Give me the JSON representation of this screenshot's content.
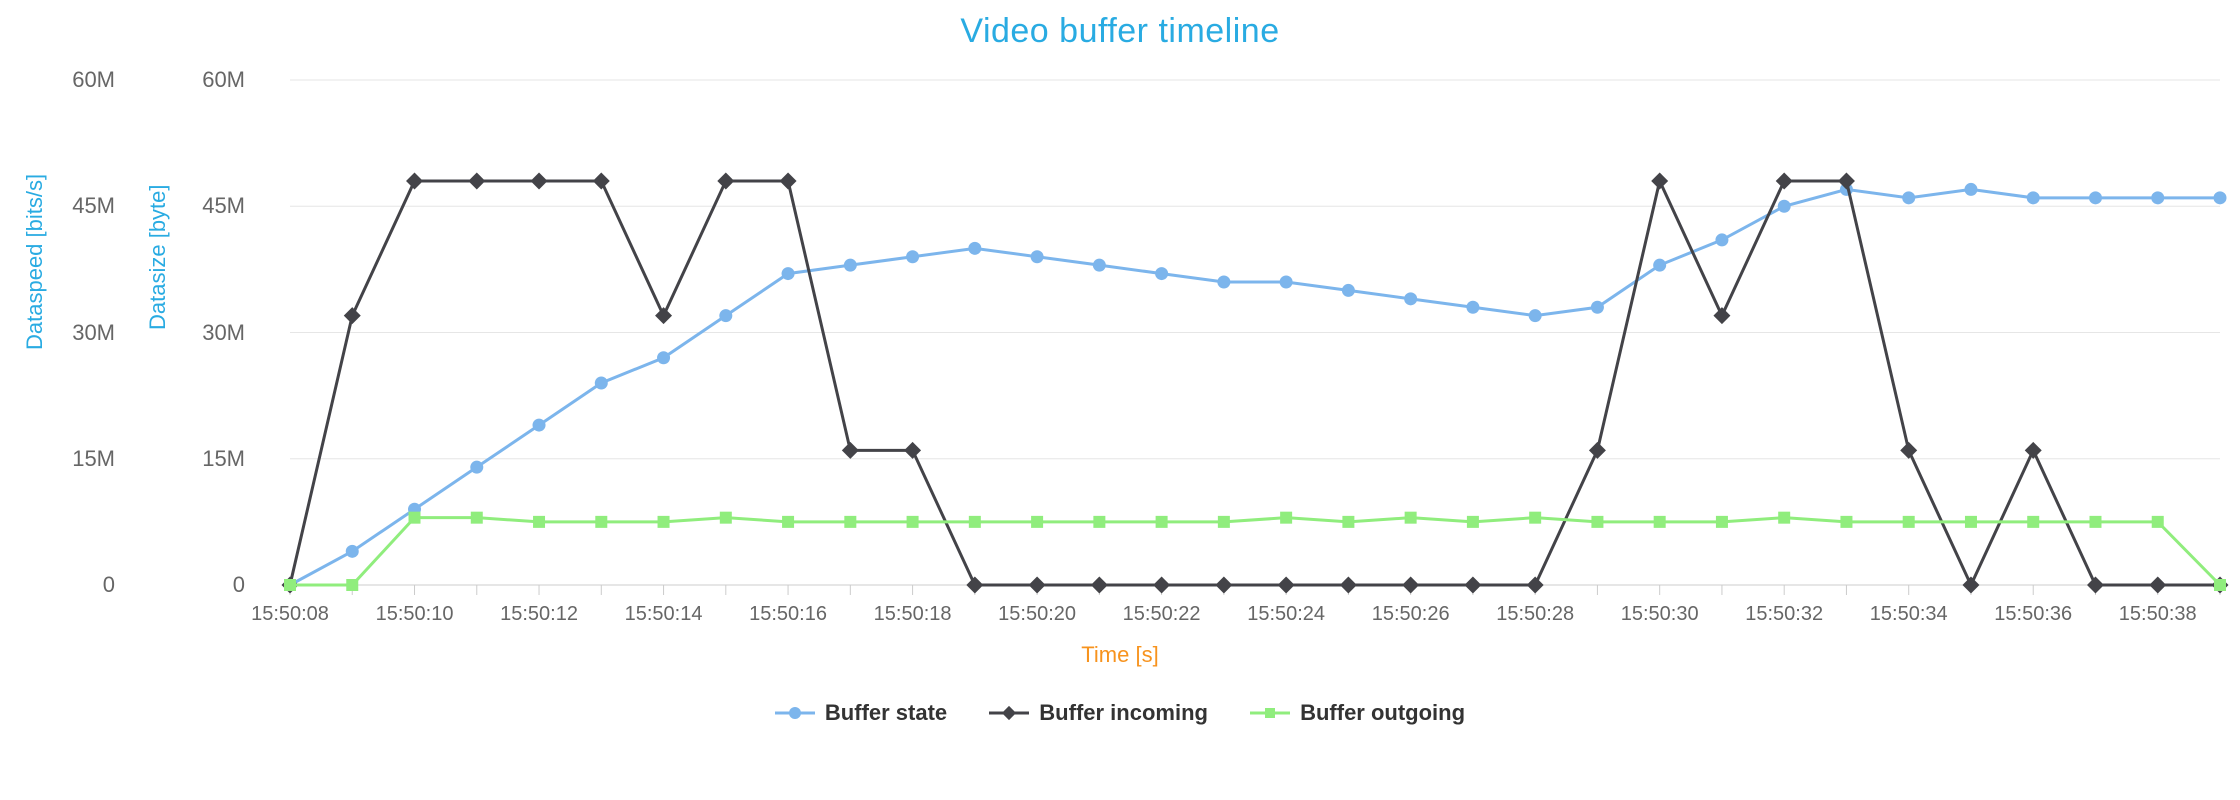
{
  "title": "Video buffer timeline",
  "axes": {
    "y1_label": "Dataspeed [bits/s]",
    "y2_label": "Datasize [byte]",
    "x_label": "Time [s]",
    "y_ticks": [
      "0",
      "15M",
      "30M",
      "45M",
      "60M"
    ],
    "x_ticks": [
      "15:50:08",
      "15:50:10",
      "15:50:12",
      "15:50:14",
      "15:50:16",
      "15:50:18",
      "15:50:20",
      "15:50:22",
      "15:50:24",
      "15:50:26",
      "15:50:28",
      "15:50:30",
      "15:50:32",
      "15:50:34",
      "15:50:36",
      "15:50:38"
    ]
  },
  "legend": {
    "s1": "Buffer state",
    "s2": "Buffer incoming",
    "s3": "Buffer outgoing"
  },
  "colors": {
    "title": "#29abe2",
    "xlabel": "#f7931e",
    "series_state": "#7cb5ec",
    "series_incoming": "#434348",
    "series_outgoing": "#90ed7d",
    "grid": "#e6e6e6",
    "tick": "#666666"
  },
  "chart_data": {
    "type": "line",
    "title": "Video buffer timeline",
    "xlabel": "Time [s]",
    "ylabel_left": "Dataspeed [bits/s]",
    "ylabel_right": "Datasize [byte]",
    "ylim": [
      0,
      60
    ],
    "y_unit": "M",
    "x": [
      "15:50:08",
      "15:50:09",
      "15:50:10",
      "15:50:11",
      "15:50:12",
      "15:50:13",
      "15:50:14",
      "15:50:15",
      "15:50:16",
      "15:50:17",
      "15:50:18",
      "15:50:19",
      "15:50:20",
      "15:50:21",
      "15:50:22",
      "15:50:23",
      "15:50:24",
      "15:50:25",
      "15:50:26",
      "15:50:27",
      "15:50:28",
      "15:50:29",
      "15:50:30",
      "15:50:31",
      "15:50:32",
      "15:50:33",
      "15:50:34",
      "15:50:35",
      "15:50:36",
      "15:50:37",
      "15:50:38",
      "15:50:39"
    ],
    "series": [
      {
        "name": "Buffer state",
        "color": "#7cb5ec",
        "marker": "circle",
        "values": [
          0,
          4,
          9,
          14,
          19,
          24,
          27,
          32,
          37,
          38,
          39,
          40,
          39,
          38,
          37,
          36,
          36,
          35,
          34,
          33,
          32,
          33,
          38,
          41,
          45,
          47,
          46,
          47,
          46,
          46,
          46,
          46
        ]
      },
      {
        "name": "Buffer incoming",
        "color": "#434348",
        "marker": "diamond",
        "values": [
          0,
          32,
          48,
          48,
          48,
          48,
          32,
          48,
          48,
          16,
          16,
          0,
          0,
          0,
          0,
          0,
          0,
          0,
          0,
          0,
          0,
          16,
          48,
          32,
          48,
          48,
          16,
          0,
          16,
          0,
          0,
          0
        ]
      },
      {
        "name": "Buffer outgoing",
        "color": "#90ed7d",
        "marker": "square",
        "values": [
          0,
          0,
          8,
          8,
          7.5,
          7.5,
          7.5,
          8,
          7.5,
          7.5,
          7.5,
          7.5,
          7.5,
          7.5,
          7.5,
          7.5,
          8,
          7.5,
          8,
          7.5,
          8,
          7.5,
          7.5,
          7.5,
          8,
          7.5,
          7.5,
          7.5,
          7.5,
          7.5,
          7.5,
          0
        ]
      }
    ]
  }
}
